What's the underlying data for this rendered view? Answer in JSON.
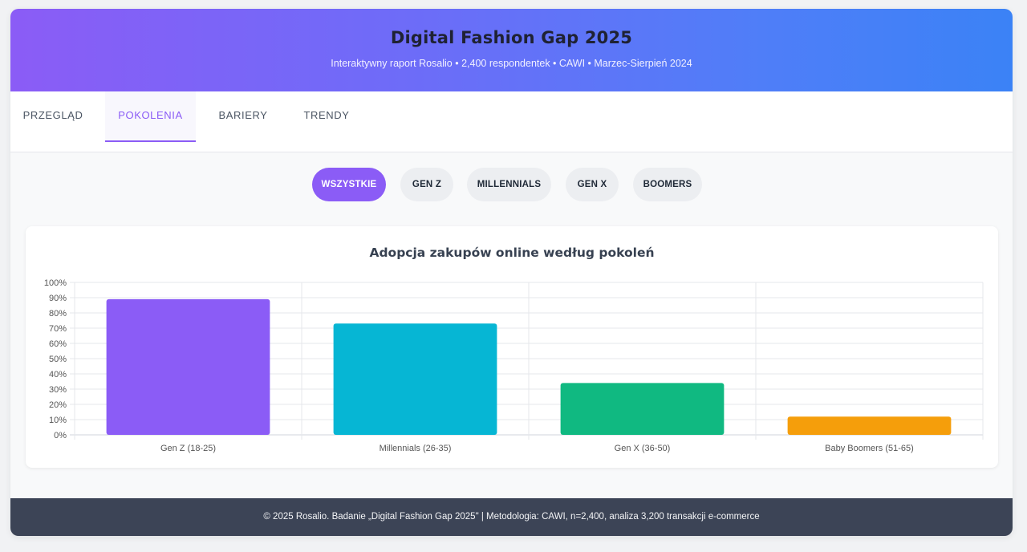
{
  "header": {
    "title": "Digital Fashion Gap 2025",
    "subtitle": "Interaktywny raport Rosalio • 2,400 respondentek • CAWI • Marzec-Sierpień 2024"
  },
  "tabs": [
    {
      "label": "PRZEGLĄD"
    },
    {
      "label": "POKOLENIA"
    },
    {
      "label": "BARIERY"
    },
    {
      "label": "TRENDY"
    }
  ],
  "active_tab": "POKOLENIA",
  "filters": [
    {
      "label": "WSZYSTKIE"
    },
    {
      "label": "GEN Z"
    },
    {
      "label": "MILLENNIALS"
    },
    {
      "label": "GEN X"
    },
    {
      "label": "BOOMERS"
    }
  ],
  "active_filter": "WSZYSTKIE",
  "colors": {
    "accent": "#8b5cf6",
    "gradient_start": "#8b5cf6",
    "gradient_end": "#3b82f6",
    "footer_bg": "#3c4456"
  },
  "chart_data": {
    "type": "bar",
    "title": "Adopcja zakupów online według pokoleń",
    "categories": [
      "Gen Z (18-25)",
      "Millennials (26-35)",
      "Gen X (36-50)",
      "Baby Boomers (51-65)"
    ],
    "values": [
      89,
      73,
      34,
      12
    ],
    "colors": [
      "#8b5cf6",
      "#06b6d4",
      "#10b981",
      "#f59e0b"
    ],
    "ylim": [
      0,
      100
    ],
    "yticks": [
      "0%",
      "10%",
      "20%",
      "30%",
      "40%",
      "50%",
      "60%",
      "70%",
      "80%",
      "90%",
      "100%"
    ],
    "grid": true,
    "xlabel": "",
    "ylabel": ""
  },
  "footer": {
    "text": "© 2025 Rosalio. Badanie „Digital Fashion Gap 2025\" | Metodologia: CAWI, n=2,400, analiza 3,200 transakcji e-commerce"
  }
}
